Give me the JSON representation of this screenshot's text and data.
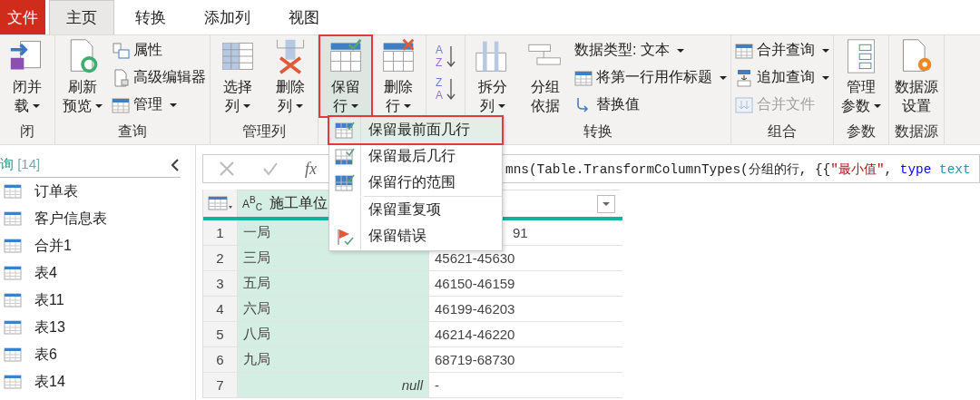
{
  "tabs": [
    {
      "label": "文件",
      "kind": "file"
    },
    {
      "label": "主页",
      "kind": "tab",
      "selected": true
    },
    {
      "label": "转换",
      "kind": "tab",
      "selected": false
    },
    {
      "label": "添加列",
      "kind": "tab",
      "selected": false
    },
    {
      "label": "视图",
      "kind": "tab",
      "selected": false
    }
  ],
  "ribbon": [
    {
      "kind": "standard",
      "label": "闭",
      "large": [
        {
          "lines": [
            "闭并",
            "载"
          ],
          "dropdown": true,
          "selected": false
        }
      ]
    },
    {
      "kind": "standard",
      "label": "查询",
      "large": [
        {
          "lines": [
            "刷新",
            "预览"
          ],
          "dropdown": true,
          "selected": false
        }
      ],
      "small": [
        {
          "label": "属性",
          "dropdown": false,
          "disabled": false
        },
        {
          "label": "高级编辑器",
          "dropdown": false,
          "disabled": false
        },
        {
          "label": "管理",
          "dropdown": true,
          "disabled": false
        }
      ]
    },
    {
      "kind": "standard",
      "label": "管理列",
      "large": [
        {
          "lines": [
            "选择",
            "列"
          ],
          "dropdown": true,
          "selected": false
        },
        {
          "lines": [
            "删除",
            "列"
          ],
          "dropdown": true,
          "selected": false
        }
      ]
    },
    {
      "kind": "standard",
      "large": [
        {
          "lines": [
            "保留",
            "行"
          ],
          "dropdown": true,
          "selected": true
        },
        {
          "lines": [
            "删除",
            "行"
          ],
          "dropdown": true,
          "selected": false
        }
      ]
    },
    {
      "kind": "sort",
      "letters": [
        [
          "A",
          "Z"
        ],
        [
          "Z",
          "A"
        ]
      ]
    },
    {
      "kind": "standard",
      "label": "转换",
      "large": [
        {
          "lines": [
            "拆分",
            "列"
          ],
          "dropdown": true,
          "selected": false
        },
        {
          "lines": [
            "分组",
            "依据"
          ],
          "dropdown": false,
          "selected": false
        }
      ],
      "small": [
        {
          "label": "数据类型: 文本",
          "dropdown": true,
          "disabled": false
        },
        {
          "label": "将第一行用作标题",
          "dropdown": true,
          "disabled": false
        },
        {
          "label": "替换值",
          "dropdown": false,
          "disabled": false
        }
      ]
    },
    {
      "kind": "standard",
      "label": "组合",
      "small": [
        {
          "label": "合并查询",
          "dropdown": true,
          "disabled": false
        },
        {
          "label": "追加查询",
          "dropdown": true,
          "disabled": false
        },
        {
          "label": "合并文件",
          "dropdown": false,
          "disabled": true
        }
      ]
    },
    {
      "kind": "standard",
      "label": "参数",
      "large": [
        {
          "lines": [
            "管理",
            "参数"
          ],
          "dropdown": true,
          "selected": false
        }
      ]
    },
    {
      "kind": "standard",
      "label": "数据源",
      "large": [
        {
          "lines": [
            "数据源",
            "设置"
          ],
          "dropdown": false,
          "selected": false
        }
      ]
    }
  ],
  "queries": {
    "title": "询",
    "count": "[14]",
    "items": [
      {
        "label": "订单表",
        "selected": false
      },
      {
        "label": "客户信息表",
        "selected": false
      },
      {
        "label": "合并1",
        "selected": false
      },
      {
        "label": "表4",
        "selected": false
      },
      {
        "label": "表11",
        "selected": false
      },
      {
        "label": "表13",
        "selected": false
      },
      {
        "label": "表6",
        "selected": false
      },
      {
        "label": "表14",
        "selected": false
      }
    ]
  },
  "formula_bar": {
    "fx": "fx",
    "segments": [
      {
        "kind": "plain",
        "text": "mns(Table.TransformColumnTypes(分组的行, {{"
      },
      {
        "kind": "string",
        "text": "\"最小值\""
      },
      {
        "kind": "plain",
        "text": ", "
      },
      {
        "kind": "keyword",
        "text": "type"
      },
      {
        "kind": "type",
        "text": "text"
      }
    ]
  },
  "table": {
    "columns": [
      {
        "type_label": "A$^{B}$$_{C}$",
        "name": "施工单位",
        "selected": true
      },
      {
        "selected": false,
        "filter": true
      }
    ],
    "rows": [
      {
        "n": "1",
        "cells": [
          {
            "text": "一局",
            "kind": "text"
          },
          {
            "text": "91",
            "kind": "covered"
          }
        ]
      },
      {
        "n": "2",
        "cells": [
          {
            "text": "三局",
            "kind": "text"
          },
          {
            "text": "45621-45630",
            "kind": "text"
          }
        ]
      },
      {
        "n": "3",
        "cells": [
          {
            "text": "五局",
            "kind": "text"
          },
          {
            "text": "46150-46159",
            "kind": "text"
          }
        ]
      },
      {
        "n": "4",
        "cells": [
          {
            "text": "六局",
            "kind": "text"
          },
          {
            "text": "46199-46203",
            "kind": "text"
          }
        ]
      },
      {
        "n": "5",
        "cells": [
          {
            "text": "八局",
            "kind": "text"
          },
          {
            "text": "46214-46220",
            "kind": "text"
          }
        ]
      },
      {
        "n": "6",
        "cells": [
          {
            "text": "九局",
            "kind": "text"
          },
          {
            "text": "68719-68730",
            "kind": "text"
          }
        ]
      },
      {
        "n": "7",
        "cells": [
          {
            "text": "null",
            "kind": "null"
          },
          {
            "text": "-",
            "kind": "text"
          }
        ]
      }
    ]
  },
  "menu": {
    "sections": [
      [
        {
          "label": "保留最前面几行",
          "selected": true
        },
        {
          "label": "保留最后几行",
          "selected": false
        },
        {
          "label": "保留行的范围",
          "selected": false
        }
      ],
      [
        {
          "label": "保留重复项",
          "selected": false
        },
        {
          "label": "保留错误",
          "selected": false
        }
      ]
    ]
  }
}
